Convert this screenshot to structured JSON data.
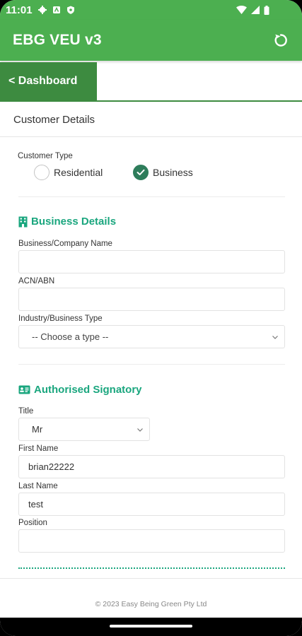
{
  "status_bar": {
    "time": "11:01"
  },
  "app_bar": {
    "title": "EBG VEU v3"
  },
  "nav": {
    "back_label": "< Dashboard"
  },
  "section_title": "Customer Details",
  "customer_type": {
    "label": "Customer Type",
    "options": [
      {
        "label": "Residential",
        "selected": false
      },
      {
        "label": "Business",
        "selected": true
      }
    ]
  },
  "business_details": {
    "heading": "Business Details",
    "company_name_label": "Business/Company Name",
    "company_name_value": "",
    "acn_label": "ACN/ABN",
    "acn_value": "",
    "industry_label": "Industry/Business Type",
    "industry_value": "-- Choose a type --"
  },
  "signatory": {
    "heading": "Authorised Signatory",
    "title_label": "Title",
    "title_value": "Mr",
    "first_name_label": "First Name",
    "first_name_value": "brian22222",
    "last_name_label": "Last Name",
    "last_name_value": "test",
    "position_label": "Position",
    "position_value": ""
  },
  "footer": {
    "copyright": "© 2023 Easy Being Green Pty Ltd"
  },
  "colors": {
    "primary": "#4caf50",
    "primary_dark": "#3d8b40",
    "accent": "#1aa67e",
    "radio_selected": "#2e7d5b"
  }
}
